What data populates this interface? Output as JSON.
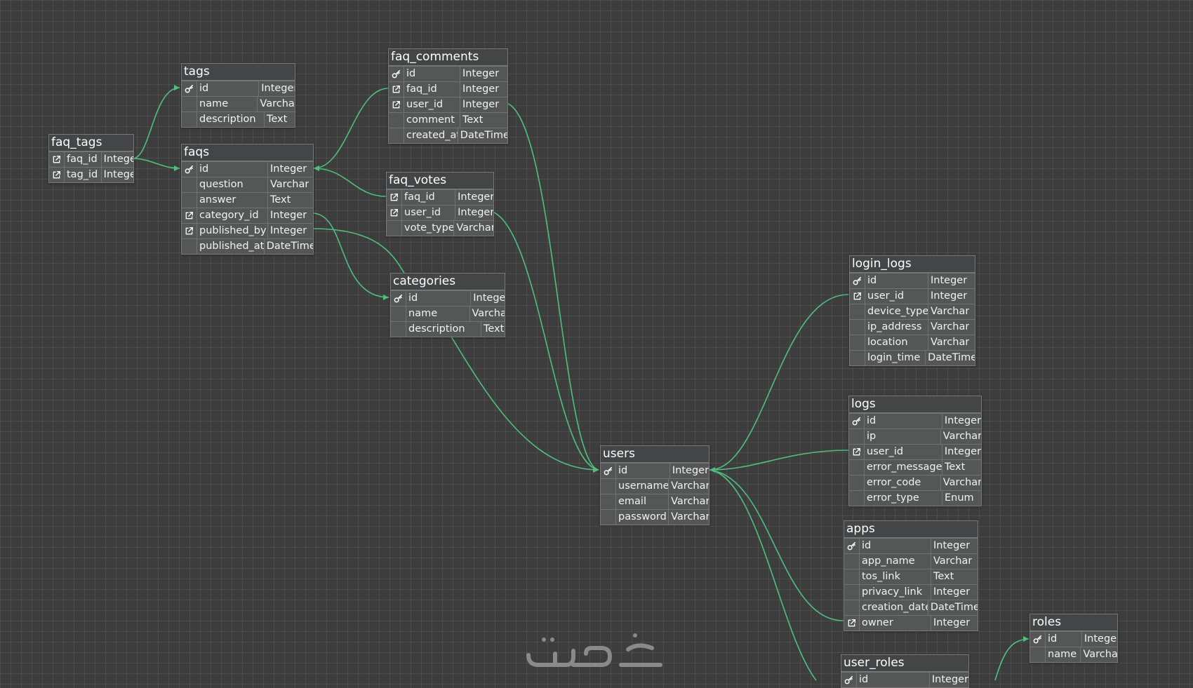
{
  "colors": {
    "background": "#3d3d3d",
    "table_header": "#434547",
    "table_body": "#555656",
    "relation_line": "#4fbf7f",
    "text": "#ffffff"
  },
  "icons": {
    "primary_key": "key-icon",
    "foreign_key": "external-link-icon"
  },
  "tables": {
    "tags": {
      "name": "tags",
      "columns": [
        {
          "key": "pk",
          "name": "id",
          "type": "Integer"
        },
        {
          "key": "",
          "name": "name",
          "type": "Varchar"
        },
        {
          "key": "",
          "name": "description",
          "type": "Text"
        }
      ]
    },
    "faq_tags": {
      "name": "faq_tags",
      "columns": [
        {
          "key": "fk",
          "name": "faq_id",
          "type": "Integer"
        },
        {
          "key": "fk",
          "name": "tag_id",
          "type": "Integer"
        }
      ]
    },
    "faqs": {
      "name": "faqs",
      "columns": [
        {
          "key": "pk",
          "name": "id",
          "type": "Integer"
        },
        {
          "key": "",
          "name": "question",
          "type": "Varchar"
        },
        {
          "key": "",
          "name": "answer",
          "type": "Text"
        },
        {
          "key": "fk",
          "name": "category_id",
          "type": "Integer"
        },
        {
          "key": "fk",
          "name": "published_by",
          "type": "Integer"
        },
        {
          "key": "",
          "name": "published_at",
          "type": "DateTime"
        }
      ]
    },
    "faq_comments": {
      "name": "faq_comments",
      "columns": [
        {
          "key": "pk",
          "name": "id",
          "type": "Integer"
        },
        {
          "key": "fk",
          "name": "faq_id",
          "type": "Integer"
        },
        {
          "key": "fk",
          "name": "user_id",
          "type": "Integer"
        },
        {
          "key": "",
          "name": "comment",
          "type": "Text"
        },
        {
          "key": "",
          "name": "created_at",
          "type": "DateTime"
        }
      ]
    },
    "faq_votes": {
      "name": "faq_votes",
      "columns": [
        {
          "key": "fk",
          "name": "faq_id",
          "type": "Integer"
        },
        {
          "key": "fk",
          "name": "user_id",
          "type": "Integer"
        },
        {
          "key": "",
          "name": "vote_type",
          "type": "Varchar"
        }
      ]
    },
    "categories": {
      "name": "categories",
      "columns": [
        {
          "key": "pk",
          "name": "id",
          "type": "Integer"
        },
        {
          "key": "",
          "name": "name",
          "type": "Varchar"
        },
        {
          "key": "",
          "name": "description",
          "type": "Text"
        }
      ]
    },
    "users": {
      "name": "users",
      "columns": [
        {
          "key": "pk",
          "name": "id",
          "type": "Integer"
        },
        {
          "key": "",
          "name": "username",
          "type": "Varchar"
        },
        {
          "key": "",
          "name": "email",
          "type": "Varchar"
        },
        {
          "key": "",
          "name": "password",
          "type": "Varchar"
        }
      ]
    },
    "login_logs": {
      "name": "login_logs",
      "columns": [
        {
          "key": "pk",
          "name": "id",
          "type": "Integer"
        },
        {
          "key": "fk",
          "name": "user_id",
          "type": "Integer"
        },
        {
          "key": "",
          "name": "device_type",
          "type": "Varchar"
        },
        {
          "key": "",
          "name": "ip_address",
          "type": "Varchar"
        },
        {
          "key": "",
          "name": "location",
          "type": "Varchar"
        },
        {
          "key": "",
          "name": "login_time",
          "type": "DateTime"
        }
      ]
    },
    "logs": {
      "name": "logs",
      "columns": [
        {
          "key": "pk",
          "name": "id",
          "type": "Integer"
        },
        {
          "key": "",
          "name": "ip",
          "type": "Varchar"
        },
        {
          "key": "fk",
          "name": "user_id",
          "type": "Integer"
        },
        {
          "key": "",
          "name": "error_message",
          "type": "Text"
        },
        {
          "key": "",
          "name": "error_code",
          "type": "Varchar"
        },
        {
          "key": "",
          "name": "error_type",
          "type": "Enum"
        }
      ]
    },
    "apps": {
      "name": "apps",
      "columns": [
        {
          "key": "pk",
          "name": "id",
          "type": "Integer"
        },
        {
          "key": "",
          "name": "app_name",
          "type": "Varchar"
        },
        {
          "key": "",
          "name": "tos_link",
          "type": "Text"
        },
        {
          "key": "",
          "name": "privacy_link",
          "type": "Integer"
        },
        {
          "key": "",
          "name": "creation_date",
          "type": "DateTime"
        },
        {
          "key": "fk",
          "name": "owner",
          "type": "Integer"
        }
      ]
    },
    "roles": {
      "name": "roles",
      "columns": [
        {
          "key": "pk",
          "name": "id",
          "type": "Integer"
        },
        {
          "key": "",
          "name": "name",
          "type": "Varchar"
        }
      ]
    },
    "user_roles": {
      "name": "user_roles",
      "columns": [
        {
          "key": "pk",
          "name": "id",
          "type": "Integer"
        }
      ]
    }
  },
  "relations": [
    {
      "from": "faq_tags.tag_id",
      "to": "tags.id"
    },
    {
      "from": "faq_tags.faq_id",
      "to": "faqs.id"
    },
    {
      "from": "faq_comments.faq_id",
      "to": "faqs.id"
    },
    {
      "from": "faq_votes.faq_id",
      "to": "faqs.id"
    },
    {
      "from": "faqs.category_id",
      "to": "categories.id"
    },
    {
      "from": "faqs.published_by",
      "to": "users.id"
    },
    {
      "from": "faq_comments.user_id",
      "to": "users.id"
    },
    {
      "from": "faq_votes.user_id",
      "to": "users.id"
    },
    {
      "from": "login_logs.user_id",
      "to": "users.id"
    },
    {
      "from": "logs.user_id",
      "to": "users.id"
    },
    {
      "from": "apps.owner",
      "to": "users.id"
    },
    {
      "from": "user_roles",
      "to": "users.id"
    },
    {
      "from": "user_roles",
      "to": "roles.id"
    }
  ]
}
